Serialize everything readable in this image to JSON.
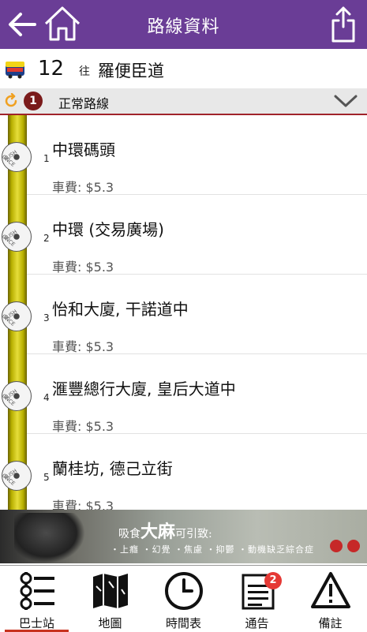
{
  "header": {
    "title": "路線資料"
  },
  "route": {
    "number": "12",
    "to_label": "往",
    "destination": "羅便臣道"
  },
  "variant": {
    "badge": "1",
    "label": "正常路線"
  },
  "stops": [
    {
      "seq": "1",
      "name": "中環碼頭",
      "fare": "車費: $5.3"
    },
    {
      "seq": "2",
      "name": "中環 (交易廣場)",
      "fare": "車費: $5.3"
    },
    {
      "seq": "3",
      "name": "怡和大廈, 干諾道中",
      "fare": "車費: $5.3"
    },
    {
      "seq": "4",
      "name": "滙豐總行大廈, 皇后大道中",
      "fare": "車費: $5.3"
    },
    {
      "seq": "5",
      "name": "蘭桂坊, 德己立街",
      "fare": "車費: $5.3"
    }
  ],
  "stop_button_text": [
    "PUSH",
    "ONCE"
  ],
  "ad": {
    "title_prefix": "吸食",
    "title_main": "大麻",
    "title_suffix": "可引致:",
    "text": "・上癮 ・幻覺 ・焦慮 ・抑鬱 ・動機缺乏綜合症"
  },
  "tabs": [
    {
      "label": "巴士站",
      "icon": "bus-stop-list-icon",
      "active": true
    },
    {
      "label": "地圖",
      "icon": "map-icon"
    },
    {
      "label": "時間表",
      "icon": "clock-icon"
    },
    {
      "label": "通告",
      "icon": "notice-icon",
      "badge": "2"
    },
    {
      "label": "備註",
      "icon": "warning-icon"
    }
  ],
  "colors": {
    "header": "#6a3d96",
    "rail": "#d8cf2e",
    "accent": "#c8321e"
  }
}
